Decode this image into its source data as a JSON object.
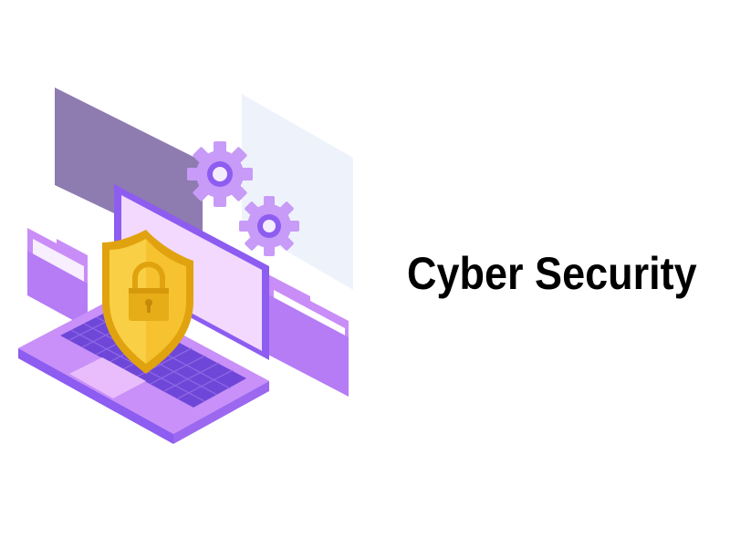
{
  "title": "Cyber Security",
  "illustration": {
    "icons": [
      "laptop-icon",
      "shield-icon",
      "padlock-icon",
      "gear-icon",
      "folder-icon",
      "document-icon"
    ],
    "colors": {
      "purple_dark": "#8d5cf0",
      "purple": "#b57cf5",
      "purple_light": "#dfb6fb",
      "purple_pale": "#f2d9fd",
      "keyboard": "#6f47d8",
      "panel_gray": "#8e7bb0",
      "panel_pale": "#eef3fb",
      "shield_gold": "#f6c22f",
      "shield_dark": "#e0a30f",
      "background": "#ffffff"
    }
  }
}
